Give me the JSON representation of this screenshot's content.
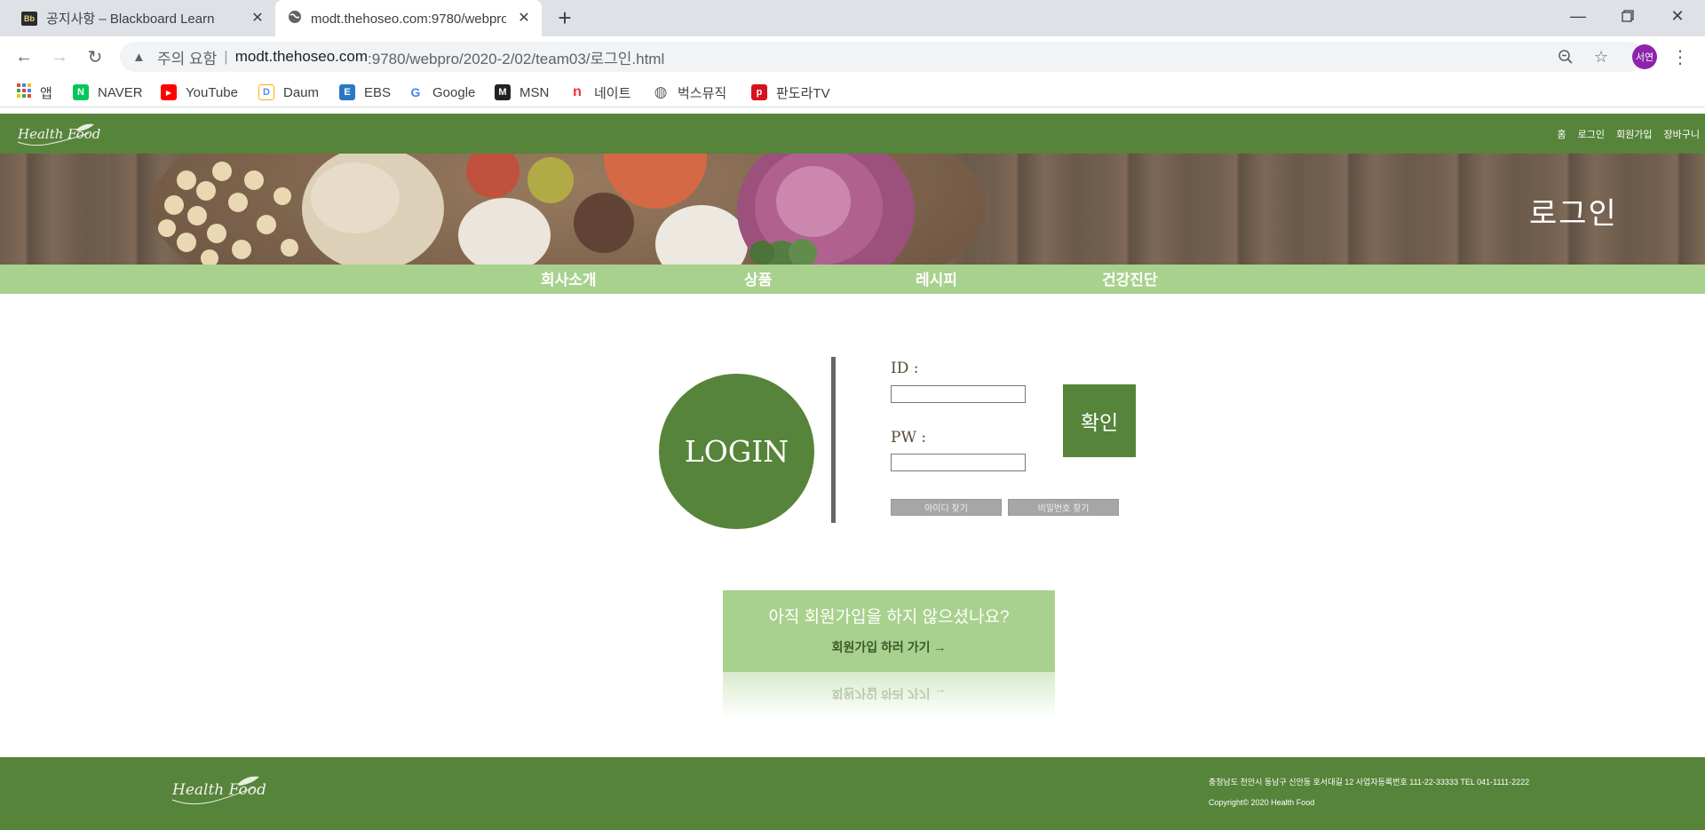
{
  "browser": {
    "tabs": [
      {
        "title": "공지사항 – Blackboard Learn",
        "favicon": "blackboard-icon",
        "favicon_text": "Bb",
        "active": false
      },
      {
        "title": "modt.thehoseo.com:9780/webpro/2020-2/02/team03/로그인.html",
        "favicon": "globe-icon",
        "active": true
      }
    ],
    "address": {
      "security_label": "주의 요함",
      "separator": "|",
      "host": "modt.thehoseo.com",
      "path": ":9780/webpro/2020-2/02/team03/로그인.html"
    },
    "profile_initials": "서연",
    "profile_color": "#8e24aa",
    "bookmarks": [
      {
        "label": "앱",
        "icon": "apps-grid-icon",
        "color": "#ea4335"
      },
      {
        "label": "NAVER",
        "icon": "naver-icon",
        "color": "#03c75a",
        "glyph": "N"
      },
      {
        "label": "YouTube",
        "icon": "youtube-icon",
        "color": "#ff0000",
        "glyph": "▶"
      },
      {
        "label": "Daum",
        "icon": "daum-icon",
        "color": "#5b8def",
        "glyph": "D"
      },
      {
        "label": "EBS",
        "icon": "ebs-icon",
        "color": "#2b78c2",
        "glyph": "E"
      },
      {
        "label": "Google",
        "icon": "google-icon",
        "color": "#4285f4",
        "glyph": "G"
      },
      {
        "label": "MSN",
        "icon": "msn-icon",
        "color": "#222222",
        "glyph": "M"
      },
      {
        "label": "네이트",
        "icon": "nate-icon",
        "color": "#ff2d2d",
        "glyph": "n"
      },
      {
        "label": "벅스뮤직",
        "icon": "globe-icon",
        "color": "#5f6368",
        "glyph": "◍"
      },
      {
        "label": "판도라TV",
        "icon": "pandoratv-icon",
        "color": "#d5121d",
        "glyph": "p"
      }
    ]
  },
  "site": {
    "colors": {
      "primary": "#56843a",
      "light": "#a9d18e"
    },
    "header_links": [
      "홈",
      "로그인",
      "회원가입",
      "장바구니"
    ],
    "banner_title": "로그인",
    "nav": [
      "회사소개",
      "상품",
      "레시피",
      "건강진단"
    ],
    "login": {
      "circle_label": "LOGIN",
      "id_label": "ID :",
      "pw_label": "PW :",
      "confirm_label": "확인",
      "find_id_label": "아이디 찾기",
      "find_pw_label": "비밀번호 찾기"
    },
    "join": {
      "question": "아직 회원가입을 하지 않으셨나요?",
      "link": "회원가입 하러 가기  →"
    },
    "footer": {
      "address": "충청남도 천안시 동남구 신안동 호서대길 12 사업자등록번호 111-22-33333 TEL 041-1111-2222",
      "copyright": "Copyright© 2020 Health Food"
    }
  }
}
